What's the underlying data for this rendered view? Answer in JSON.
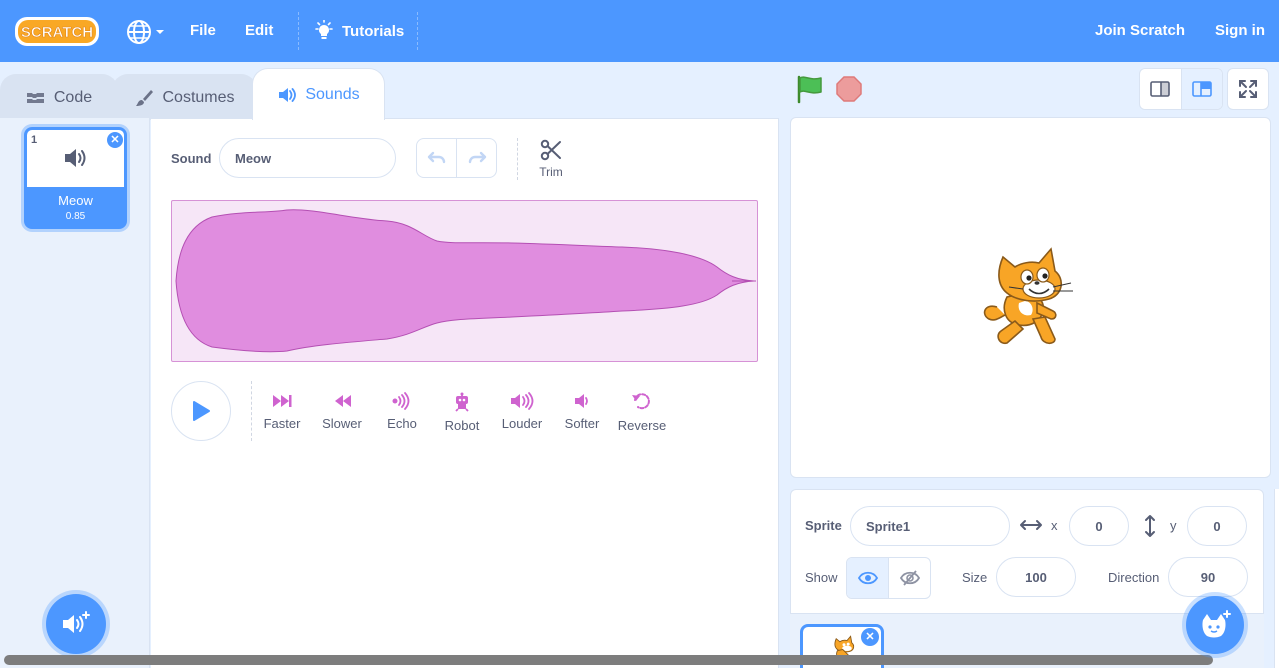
{
  "menubar": {
    "logo_text": "SCRATCH",
    "file": "File",
    "edit": "Edit",
    "tutorials": "Tutorials",
    "join": "Join Scratch",
    "signin": "Sign in",
    "color": "#4c97ff"
  },
  "tabs": [
    {
      "label": "Code",
      "icon": "code-blocks-icon"
    },
    {
      "label": "Costumes",
      "icon": "paintbrush-icon"
    },
    {
      "label": "Sounds",
      "icon": "speaker-icon",
      "active": true
    }
  ],
  "sound_list": {
    "items": [
      {
        "number": "1",
        "name": "Meow",
        "duration": "0.85"
      }
    ]
  },
  "editor": {
    "sound_label": "Sound",
    "sound_name": "Meow",
    "trim_label": "Trim",
    "effects": [
      {
        "label": "Faster",
        "icon": "faster-icon"
      },
      {
        "label": "Slower",
        "icon": "slower-icon"
      },
      {
        "label": "Echo",
        "icon": "echo-icon"
      },
      {
        "label": "Robot",
        "icon": "robot-icon"
      },
      {
        "label": "Louder",
        "icon": "louder-icon"
      },
      {
        "label": "Softer",
        "icon": "softer-icon"
      },
      {
        "label": "Reverse",
        "icon": "reverse-icon"
      }
    ],
    "waveform_color": "#cf63cf"
  },
  "sprite_info": {
    "sprite_label": "Sprite",
    "sprite_name": "Sprite1",
    "x_label": "x",
    "x_value": "0",
    "y_label": "y",
    "y_value": "0",
    "show_label": "Show",
    "size_label": "Size",
    "size_value": "100",
    "direction_label": "Direction",
    "direction_value": "90"
  }
}
